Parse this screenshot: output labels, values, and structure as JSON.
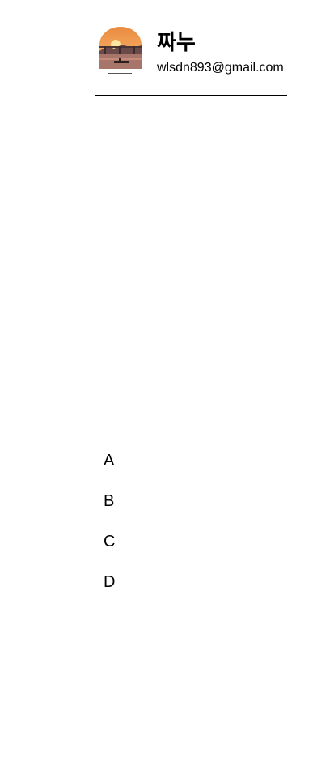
{
  "profile": {
    "name": "짜누",
    "email": "wlsdn893@gmail.com",
    "avatar_icon": "sunset-bridge-photo"
  },
  "menu": {
    "items": [
      {
        "label": "A"
      },
      {
        "label": "B"
      },
      {
        "label": "C"
      },
      {
        "label": "D"
      }
    ]
  },
  "colors": {
    "background": "#ffffff",
    "text": "#000000",
    "divider": "#000000"
  }
}
